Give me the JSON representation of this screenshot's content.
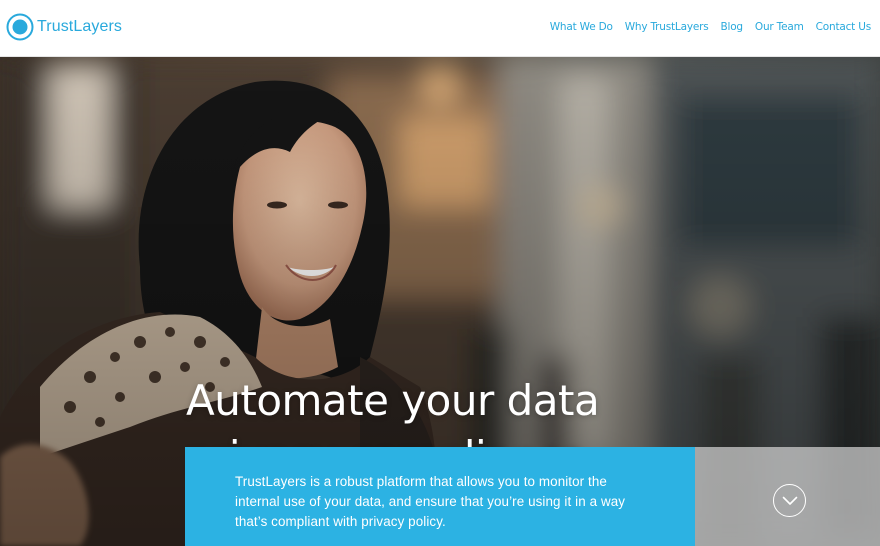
{
  "brand": {
    "name": "TrustLayers",
    "accent": "#29a9dc",
    "logo_icon": "concentric-circle-icon"
  },
  "nav": {
    "items": [
      {
        "label": "What We Do"
      },
      {
        "label": "Why TrustLayers"
      },
      {
        "label": "Blog"
      },
      {
        "label": "Our Team"
      },
      {
        "label": "Contact Us"
      }
    ]
  },
  "hero": {
    "headline_line1": "Automate your data",
    "headline_line2": "privacy compliance.",
    "description": "TrustLayers is a robust platform that allows you to monitor the internal use of your data, and ensure that you’re using it in a way that’s compliant with privacy policy.",
    "info_bg": "#2cb2e3",
    "scroll_icon": "chevron-down-icon"
  }
}
